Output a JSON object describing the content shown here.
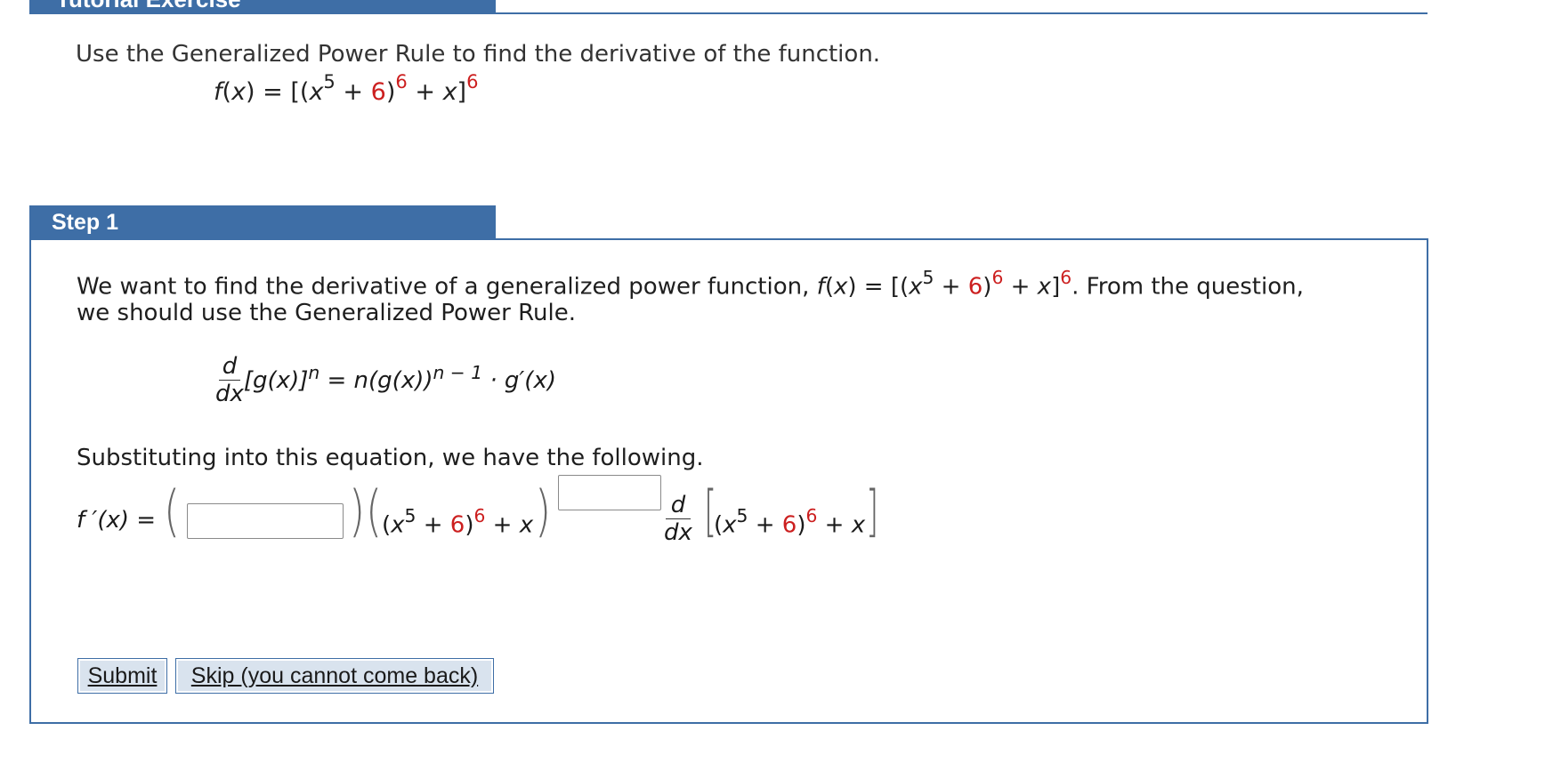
{
  "header": {
    "title": "Tutorial Exercise"
  },
  "question": {
    "instruction": "Use the Generalized Power Rule to find the derivative of the function.",
    "function_lhs": "f(x) = [(x",
    "exp_inner": "5",
    "plus": " + ",
    "const": "6",
    "paren_close": ")",
    "exp_mid": "6",
    "tail": " + x]",
    "exp_outer": "6"
  },
  "step": {
    "label": "Step 1",
    "para1_a": "We want to find the derivative of a generalized power function, ",
    "para1_fx": "f",
    "para1_b": "(x) = [(x",
    "para1_c": ". From the question,",
    "para2": "we should use the Generalized Power Rule.",
    "rule": {
      "d": "d",
      "dx": "dx",
      "lhs": "[g(x)]",
      "n": "n",
      "eq": " = ",
      "rhs_a": "n(g(x))",
      "rhs_exp": "n − 1",
      "rhs_b": " · g′(x)"
    },
    "substitute_text": "Substituting into this equation, we have the following.",
    "fprime": "f ′(x) =",
    "expr_inner_a": "(x",
    "expr_exp5": "5",
    "expr_plus": " + ",
    "expr_six": "6",
    "expr_close": ")",
    "expr_exp6": "6",
    "expr_plus_x": " + x"
  },
  "inputs": {
    "coefficient_value": "",
    "exponent_value": ""
  },
  "buttons": {
    "submit": "Submit",
    "skip": "Skip (you cannot come back)"
  },
  "colors": {
    "accent": "#3e6ea6",
    "highlight_red": "#cc1f1f"
  }
}
